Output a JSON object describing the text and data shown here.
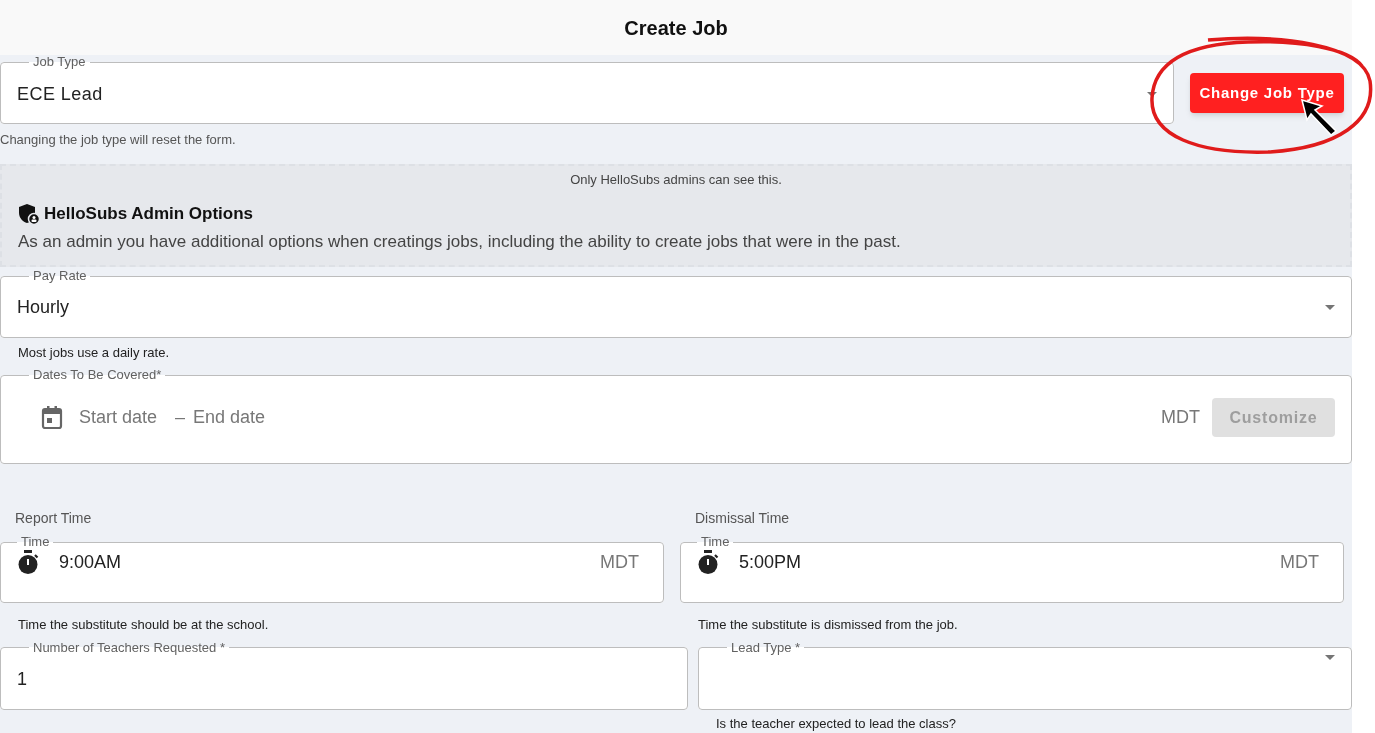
{
  "header": {
    "title": "Create Job"
  },
  "job_type": {
    "label": "Job Type",
    "value": "ECE Lead",
    "helper": "Changing the job type will reset the form.",
    "button": "Change Job Type"
  },
  "admin_panel": {
    "notice": "Only HelloSubs admins can see this.",
    "title": "HelloSubs Admin Options",
    "description": "As an admin you have additional options when creatings jobs, including the ability to create jobs that were in the past."
  },
  "pay_rate": {
    "label": "Pay Rate",
    "value": "Hourly",
    "helper": "Most jobs use a daily rate."
  },
  "dates": {
    "label": "Dates To Be Covered*",
    "start_placeholder": "Start date",
    "separator": "–",
    "end_placeholder": "End date",
    "timezone": "MDT",
    "button": {
      "label": "Customize",
      "disabled": true
    }
  },
  "times": [
    {
      "heading": "Report Time",
      "label": "Time",
      "value": "9:00AM",
      "timezone": "MDT",
      "helper": "Time the substitute should be at the school."
    },
    {
      "heading": "Dismissal Time",
      "label": "Time",
      "value": "5:00PM",
      "timezone": "MDT",
      "helper": "Time the substitute is dismissed from the job."
    }
  ],
  "teachers": {
    "label": "Number of Teachers Requested *",
    "value": "1"
  },
  "lead_type": {
    "label": "Lead Type *",
    "helper": "Is the teacher expected to lead the class?"
  }
}
